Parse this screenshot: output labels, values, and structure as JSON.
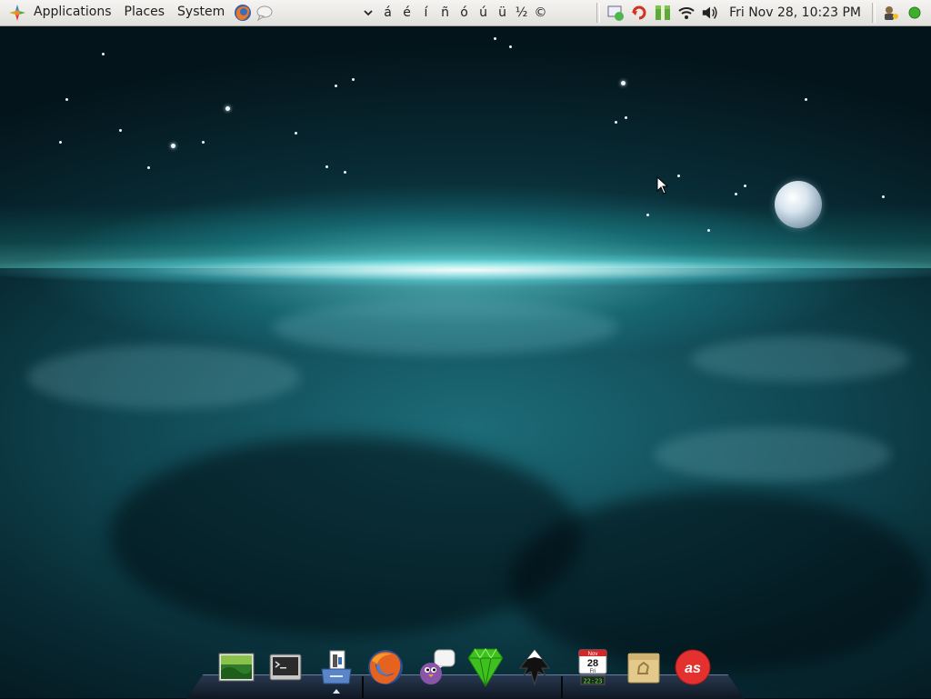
{
  "top_panel": {
    "menus": [
      "Applications",
      "Places",
      "System"
    ],
    "special_chars": [
      "á",
      "é",
      "í",
      "ñ",
      "ó",
      "ú",
      "ü",
      "½",
      "©"
    ],
    "clock": "Fri Nov 28, 10:23 PM"
  },
  "dock": {
    "items": [
      {
        "name": "image-viewer",
        "icon": "photo-icon"
      },
      {
        "name": "terminal",
        "icon": "terminal-icon"
      },
      {
        "name": "file-manager",
        "icon": "folder-icon",
        "running": true
      },
      {
        "name": "firefox",
        "icon": "firefox-icon"
      },
      {
        "name": "pidgin",
        "icon": "pidgin-icon"
      },
      {
        "name": "emerald",
        "icon": "emerald-icon"
      },
      {
        "name": "inkscape",
        "icon": "inkscape-icon"
      },
      {
        "name": "calendar",
        "icon": "calendar-icon"
      },
      {
        "name": "trash",
        "icon": "trash-icon"
      },
      {
        "name": "lastfm",
        "icon": "lastfm-icon"
      }
    ],
    "calendar_icon": {
      "month": "Nov",
      "day": "28",
      "weekday": "Fri",
      "time": "22:23"
    },
    "lastfm_label": "as"
  },
  "colors": {
    "panel": "#e8e6e2",
    "accent_teal": "#3fd0d6"
  }
}
